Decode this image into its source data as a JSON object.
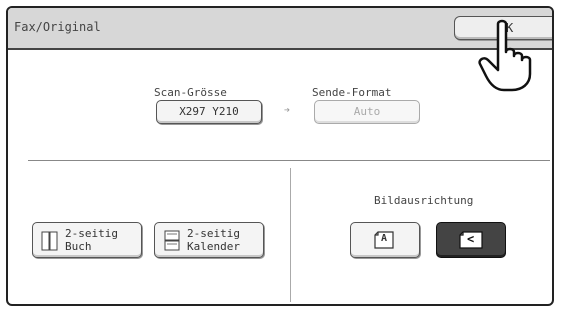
{
  "header": {
    "title": "Fax/Original",
    "ok_label": "OK"
  },
  "scan_size": {
    "label": "Scan-Grösse",
    "value": "X297 Y210"
  },
  "send_format": {
    "label": "Sende-Format",
    "value": "Auto"
  },
  "duplex": {
    "book": {
      "line1": "2-seitig",
      "line2": "Buch"
    },
    "calendar": {
      "line1": "2-seitig",
      "line2": "Kalender"
    }
  },
  "orientation": {
    "label": "Bildausrichtung",
    "options": [
      {
        "glyph": "A",
        "selected": false
      },
      {
        "glyph": "<",
        "selected": true
      }
    ]
  },
  "colors": {
    "titlebar": "#d7d7d7",
    "selected_bg": "#444444"
  }
}
